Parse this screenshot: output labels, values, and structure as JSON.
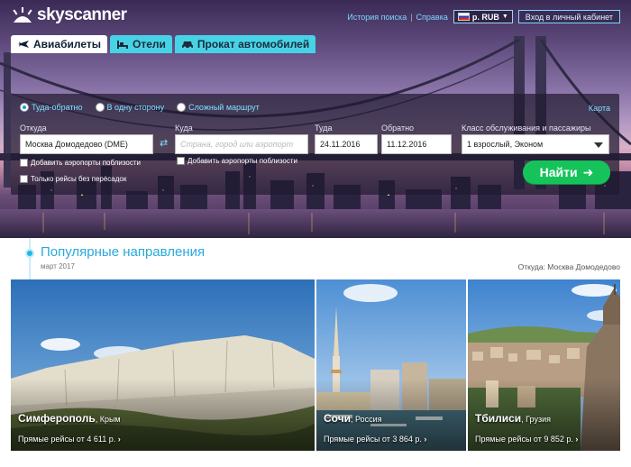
{
  "header": {
    "logo_text": "skyscanner",
    "links": [
      "История поиска",
      "Справка"
    ],
    "currency": "р. RUB",
    "login": "Вход в личный кабинет"
  },
  "tabs": [
    {
      "label": "Авиабилеты",
      "icon": "plane-icon",
      "active": true
    },
    {
      "label": "Отели",
      "icon": "bed-icon",
      "active": false
    },
    {
      "label": "Прокат автомобилей",
      "icon": "car-icon",
      "active": false
    }
  ],
  "search": {
    "trip_types": [
      "Туда-обратно",
      "В одну сторону",
      "Сложный маршрут"
    ],
    "map_link": "Карта",
    "from_label": "Откуда",
    "from_value": "Москва Домодедово (DME)",
    "to_label": "Куда",
    "to_placeholder": "Страна, город или аэропорт",
    "depart_label": "Туда",
    "depart_value": "24.11.2016",
    "return_label": "Обратно",
    "return_value": "11.12.2016",
    "class_label": "Класс обслуживания и пассажиры",
    "class_value": "1 взрослый, Эконом",
    "nearby_from": "Добавить аэропорты поблизости",
    "nearby_to": "Добавить аэропорты поблизости",
    "direct_only": "Только рейсы без пересадок",
    "search_button": "Найти"
  },
  "popular": {
    "title": "Популярные направления",
    "date": "март 2017",
    "from": "Откуда: Москва Домодедово",
    "cards": [
      {
        "city": "Симферополь",
        "country": ", Крым",
        "price": "Прямые рейсы от 4 611 р."
      },
      {
        "city": "Сочи",
        "country": ", Россия",
        "price": "Прямые рейсы от 3 864 р."
      },
      {
        "city": "Тбилиси",
        "country": ", Грузия",
        "price": "Прямые рейсы от 9 852 р."
      }
    ]
  },
  "colors": {
    "accent": "#29a9da",
    "search_button": "#16c35b",
    "tab": "#47d3e6"
  }
}
